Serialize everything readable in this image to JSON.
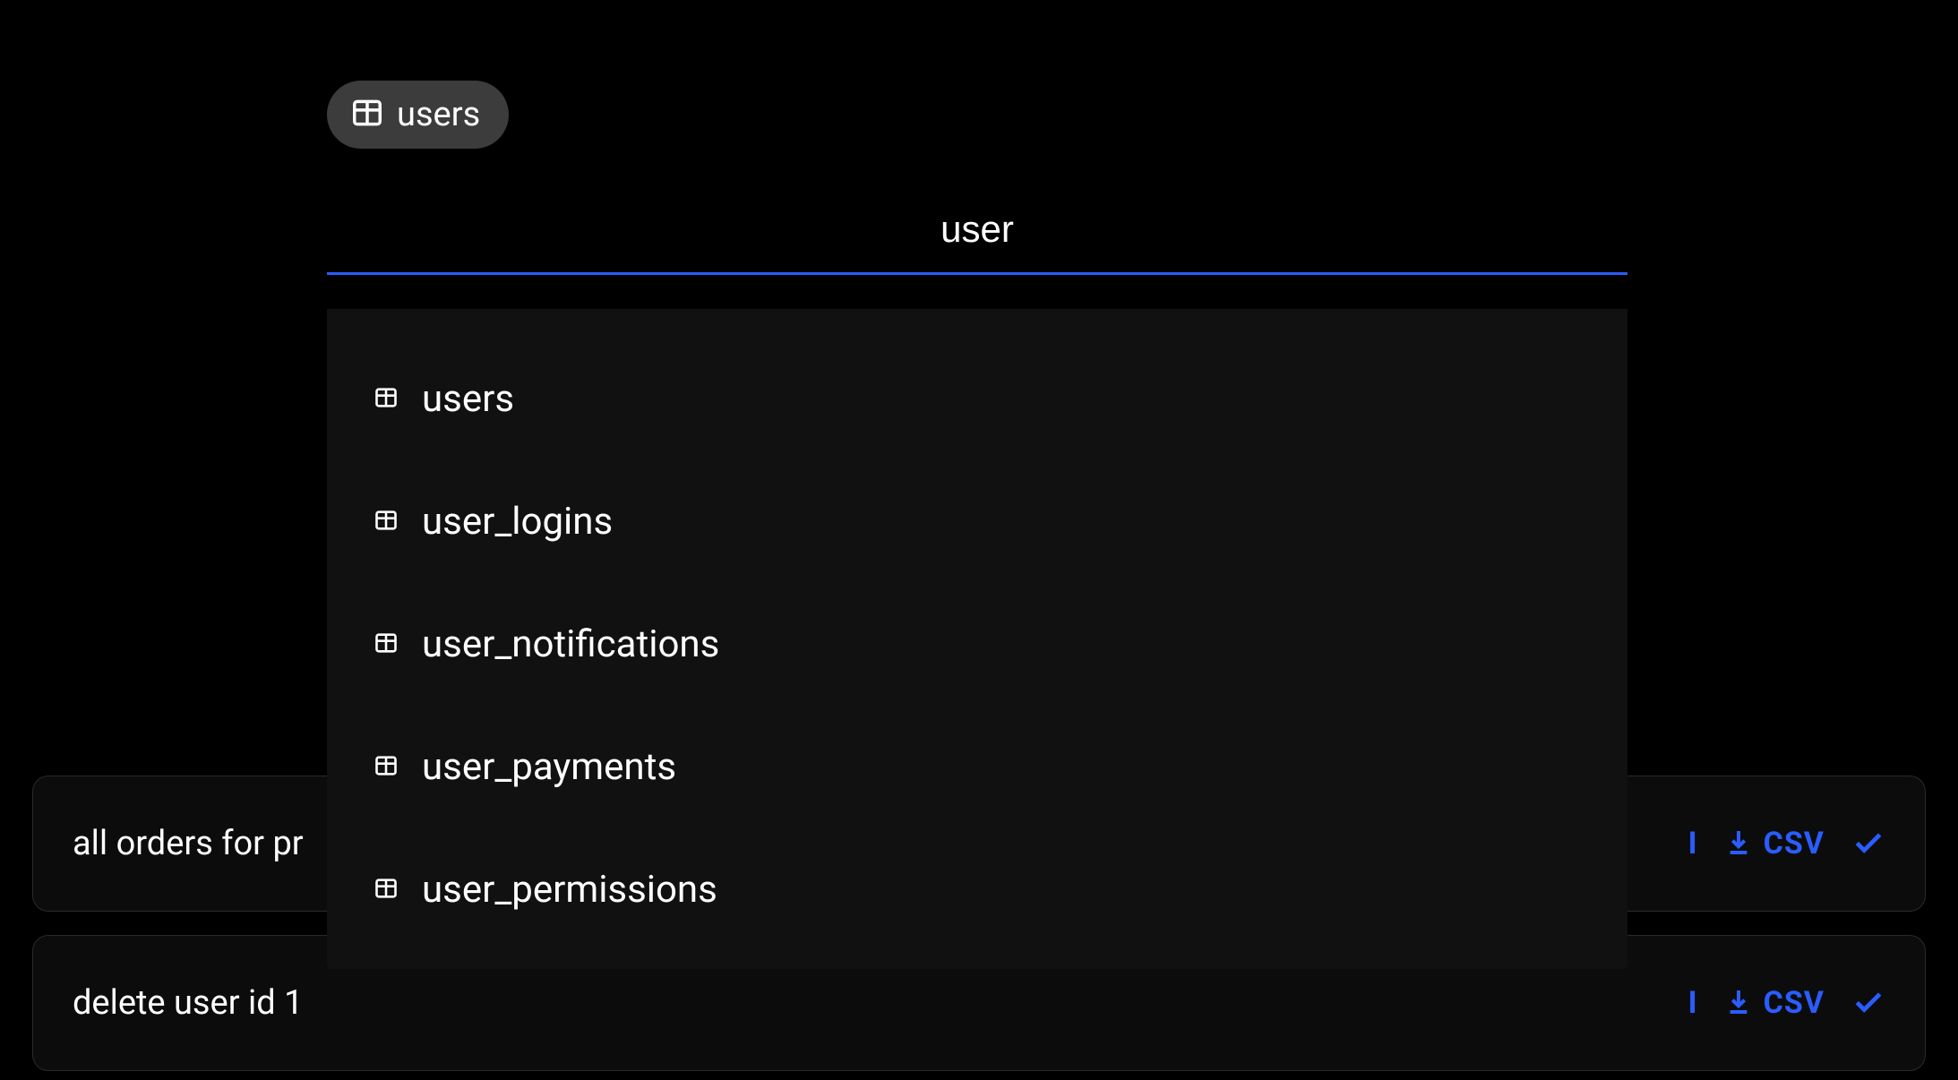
{
  "chip": {
    "label": "users"
  },
  "search": {
    "value": "user"
  },
  "dropdown": {
    "items": [
      {
        "label": "users"
      },
      {
        "label": "user_logins"
      },
      {
        "label": "user_notifications"
      },
      {
        "label": "user_payments"
      },
      {
        "label": "user_permissions"
      }
    ]
  },
  "history": {
    "items": [
      {
        "query": "all orders for pr",
        "frag": "I",
        "csv": "CSV"
      },
      {
        "query": "delete user id 1",
        "frag": "I",
        "csv": "CSV"
      }
    ]
  },
  "colors": {
    "accent": "#2a5dff",
    "bg": "#000000",
    "panel": "#111111",
    "chip": "#3c3c3c"
  }
}
